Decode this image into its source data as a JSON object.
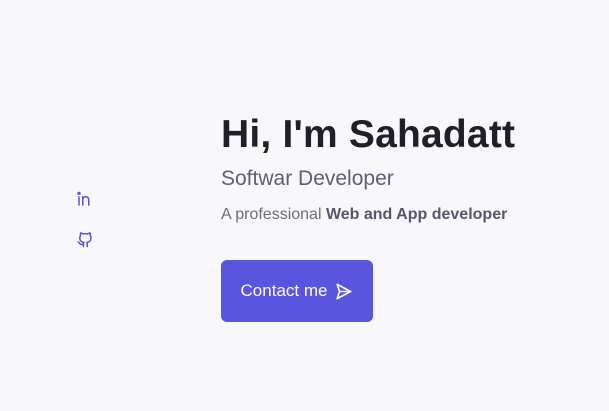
{
  "social": {
    "items": [
      {
        "icon": "linkedin-icon"
      },
      {
        "icon": "github-icon"
      }
    ]
  },
  "hero": {
    "title": "Hi, I'm Sahadatt",
    "subtitle": "Softwar Developer",
    "description_prefix": "A professional ",
    "description_emphasis": "Web and App developer",
    "contact_label": "Contact me",
    "contact_icon": "send-icon"
  },
  "colors": {
    "background": "#f8f7fb",
    "accent": "#5a55df",
    "heading": "#1f1f27",
    "subtext": "#5d5f73"
  }
}
